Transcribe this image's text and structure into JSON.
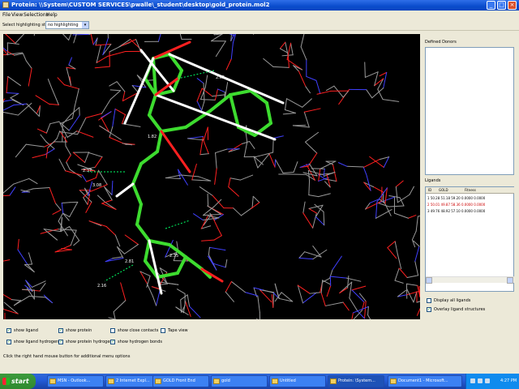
{
  "window": {
    "title": "Protein: \\\\System\\CUSTOM SERVICES\\pwalle\\_student\\desktop\\gold_protein.mol2"
  },
  "menu": [
    "File",
    "View",
    "Selections",
    "Help"
  ],
  "toolbar": {
    "label": "Select highlighting style:",
    "select_value": "no highlighting"
  },
  "viewer": {
    "distance_labels": [
      "2.65",
      "1.82",
      "2.37",
      "3.08",
      "2.81",
      "2.35",
      "2.16"
    ]
  },
  "side": {
    "defined_donors_label": "Defined Donors",
    "ligands_label": "Ligands",
    "ligand_columns": [
      "ID",
      "GOLD",
      "Fitness"
    ],
    "ligand_rows": [
      {
        "text": "1  50.28  51.18  59.20  0.0000  0.0000",
        "color": "#000000"
      },
      {
        "text": "2  50.01  49.87  58.36  0.0000  0.0000",
        "color": "#cc0000"
      },
      {
        "text": "3  49.76  48.92  57.10  0.0000  0.0000",
        "color": "#000000"
      }
    ],
    "display_all_label": "Display all ligands",
    "overlay_label": "Overlay ligand structures",
    "display_all_checked": false,
    "overlay_checked": true
  },
  "options": [
    {
      "label": "show ligand",
      "checked": true
    },
    {
      "label": "show protein",
      "checked": true
    },
    {
      "label": "show close contacts",
      "checked": false
    },
    {
      "label": "Tape view",
      "checked": false
    },
    {
      "label": "show ligand hydrogens",
      "checked": true
    },
    {
      "label": "show protein hydrogens",
      "checked": true
    },
    {
      "label": "show hydrogen bonds",
      "checked": true
    }
  ],
  "status": "Click the right hand mouse button for additional menu options",
  "taskbar": {
    "start_label": "start",
    "tasks": [
      {
        "label": "MSN - Outlook..."
      },
      {
        "label": "2 Internet Expl..."
      },
      {
        "label": "GOLD Front End"
      },
      {
        "label": "gold"
      },
      {
        "label": "Untitled"
      },
      {
        "label": "Protein: \\System..."
      },
      {
        "label": "Document1 - Microsoft..."
      }
    ],
    "clock": "4:27 PM"
  },
  "colors": {
    "ligand": "#3ddc2f",
    "hydrogen": "#ffffff",
    "oxygen": "#ff2020",
    "nitrogen": "#4040ff",
    "carbon": "#9a9a9a",
    "hbond": "#00ff66"
  }
}
